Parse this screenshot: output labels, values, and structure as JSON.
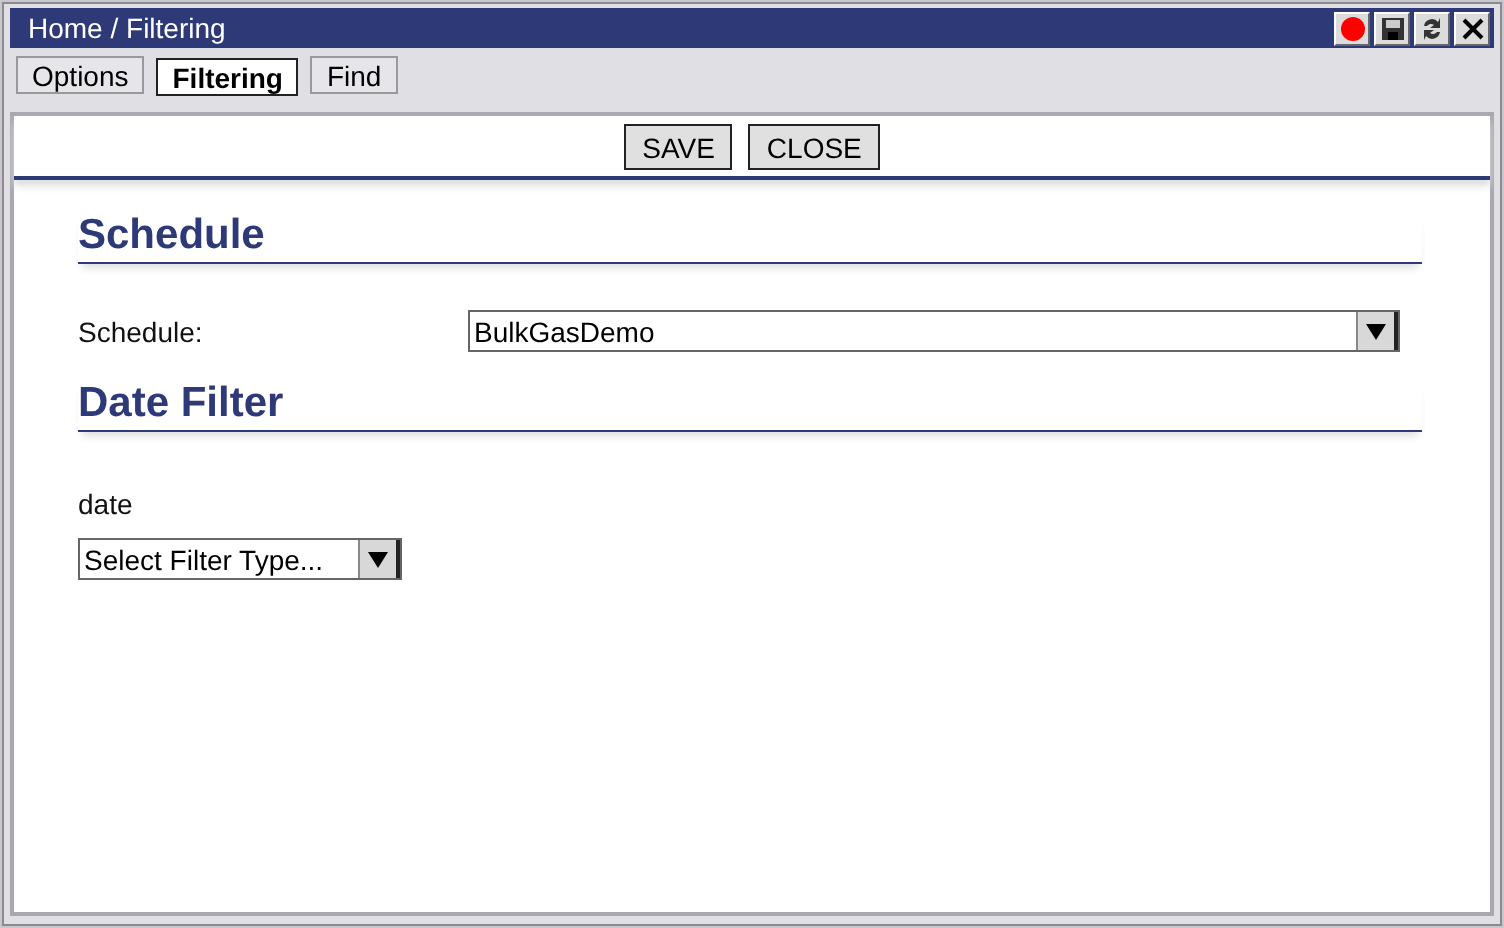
{
  "window": {
    "title": "Home / Filtering",
    "controls": [
      {
        "kind": "record"
      },
      {
        "kind": "save"
      },
      {
        "kind": "refresh"
      },
      {
        "kind": "close"
      }
    ]
  },
  "tabs": [
    {
      "label": "Options",
      "selected": false
    },
    {
      "label": "Filtering",
      "selected": true
    },
    {
      "label": "Find",
      "selected": false
    }
  ],
  "toolbar": {
    "buttons": [
      "SAVE",
      "CLOSE"
    ]
  },
  "sections": [
    {
      "heading": "Schedule",
      "fields": [
        {
          "kind": "inline",
          "label": "Schedule:",
          "value": "BulkGasDemo"
        }
      ]
    },
    {
      "heading": "Date Filter",
      "fields": [
        {
          "kind": "stacked",
          "label": "date",
          "value": "Select Filter Type..."
        }
      ]
    }
  ]
}
